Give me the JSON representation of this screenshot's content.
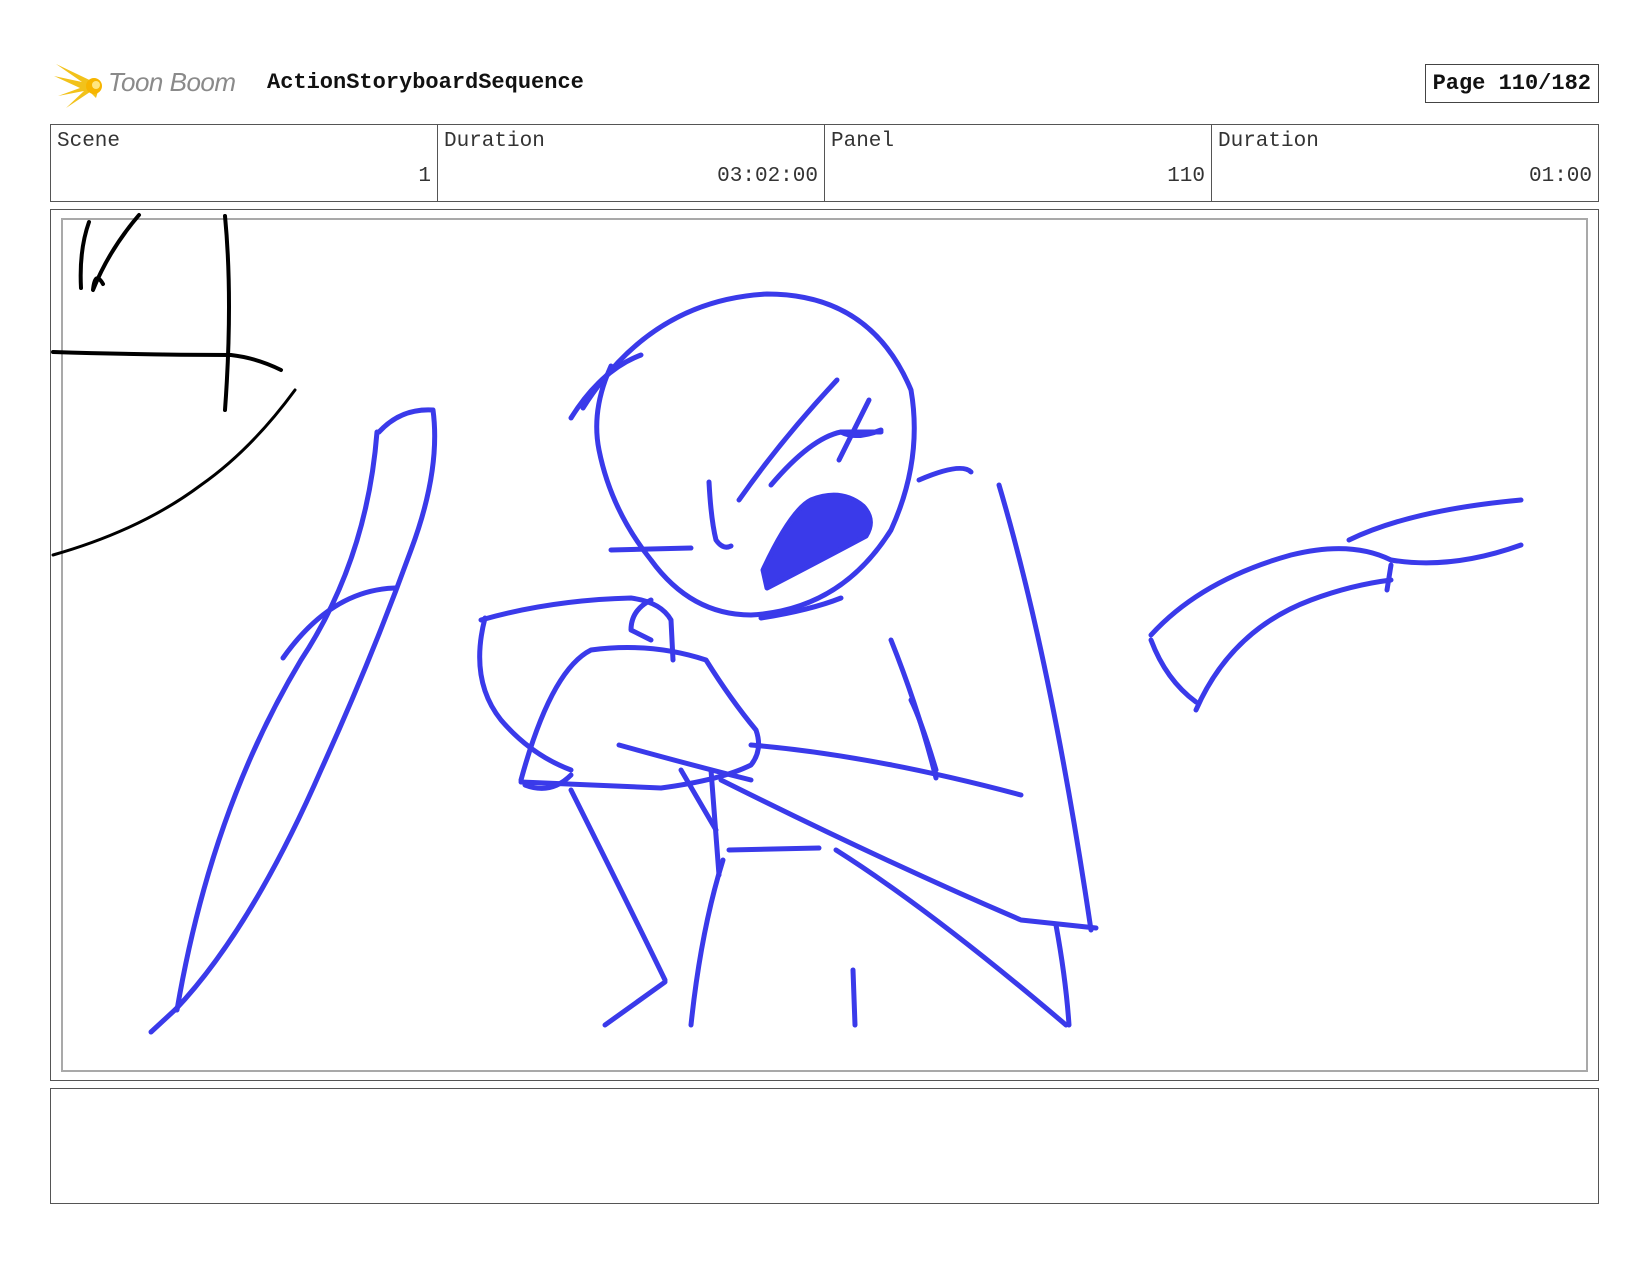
{
  "header": {
    "logo_text": "Toon Boom",
    "project_title": "ActionStoryboardSequence",
    "page_label": "Page 110/182"
  },
  "info": {
    "scene_label": "Scene",
    "scene_value": "1",
    "scene_duration_label": "Duration",
    "scene_duration_value": "03:02:00",
    "panel_label": "Panel",
    "panel_value": "110",
    "panel_duration_label": "Duration",
    "panel_duration_value": "01:00"
  },
  "colors": {
    "sketch_blue": "#3a3aea",
    "sketch_black": "#000000",
    "logo_yellow": "#f2c21b"
  },
  "notes": {
    "text": ""
  }
}
